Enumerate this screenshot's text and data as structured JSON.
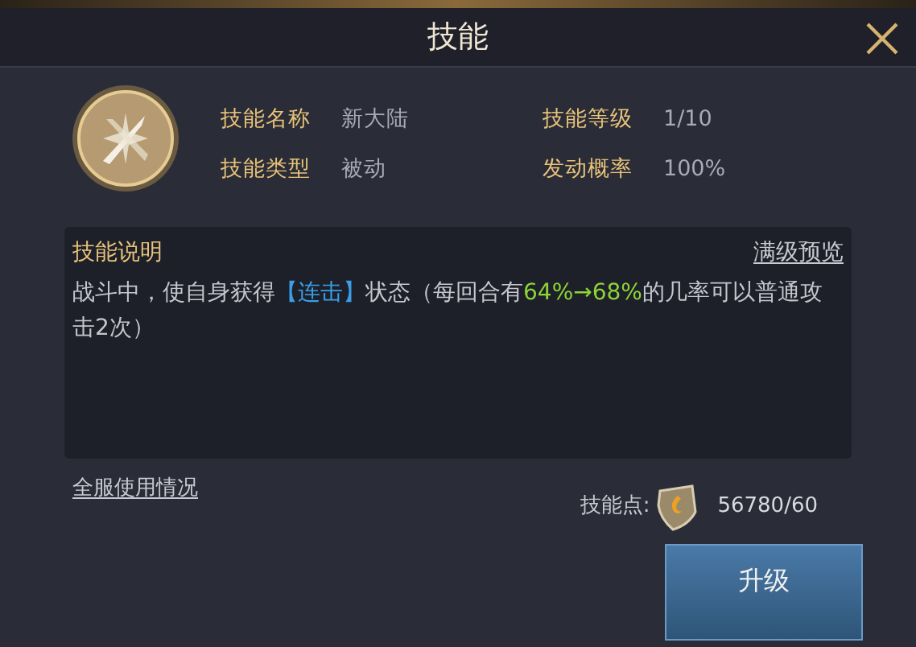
{
  "window": {
    "title": "技能"
  },
  "info": [
    {
      "label": "技能名称",
      "value": "新大陆"
    },
    {
      "label": "技能等级",
      "value": "1/10"
    },
    {
      "label": "技能类型",
      "value": "被动"
    },
    {
      "label": "发动概率",
      "value": "100%"
    }
  ],
  "description": {
    "title": "技能说明",
    "link": "满级预览",
    "segments": [
      {
        "kind": "normal",
        "text": "战斗中，使自身获得"
      },
      {
        "kind": "keyword",
        "text": "【连击】"
      },
      {
        "kind": "normal",
        "text": "状态（每回合有"
      },
      {
        "kind": "value",
        "text": "64%→68%"
      },
      {
        "kind": "normal",
        "text": "的几率可以普通攻击2次）"
      }
    ]
  },
  "usage_link": "全服使用情况",
  "skill_points": {
    "label": "技能点:",
    "value": "56780/60"
  },
  "upgrade_button": "升级"
}
